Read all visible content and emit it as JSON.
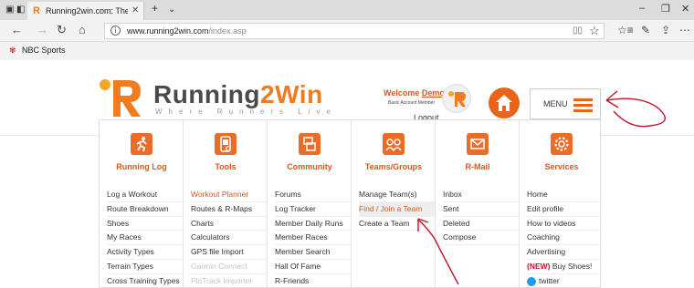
{
  "browser": {
    "tab_title": "Running2win.com: The",
    "url_domain": "www.running2win.com",
    "url_path": "/index.asp",
    "favorite": "NBC Sports"
  },
  "header": {
    "logo_word_a": "Running",
    "logo_word_b": "2Win",
    "tagline": "Where Runners Live",
    "welcome_prefix": "Welcome",
    "username": "Demo",
    "member_type": "Basic Account Member",
    "logout": "Logout",
    "menu_label": "MENU"
  },
  "menu": {
    "columns": [
      {
        "title": "Running Log",
        "icon": "runner-icon",
        "items": [
          "Log a Workout",
          "Route Breakdown",
          "Shoes",
          "My Races",
          "Activity Types",
          "Terrain Types",
          "Cross Training Types"
        ]
      },
      {
        "title": "Tools",
        "icon": "gps-device-icon",
        "items": [
          "Workout Planner",
          "Routes & R-Maps",
          "Charts",
          "Calculators",
          "GPS file Import",
          "Garmin Connect",
          "PloTrack Importer"
        ]
      },
      {
        "title": "Community",
        "icon": "community-icon",
        "items": [
          "Forums",
          "Log Tracker",
          "Member Daily Runs",
          "Member Races",
          "Member Search",
          "Hall Of Fame",
          "R-Friends"
        ]
      },
      {
        "title": "Teams/Groups",
        "icon": "group-icon",
        "items": [
          "Manage Team(s)",
          "Find / Join a Team",
          "Create a Team"
        ]
      },
      {
        "title": "R-Mail",
        "icon": "envelope-icon",
        "items": [
          "Inbox",
          "Sent",
          "Deleted",
          "Compose"
        ]
      },
      {
        "title": "Services",
        "icon": "gear-icon",
        "items": [
          "Home",
          "Edit profile",
          "How to videos",
          "Coaching",
          "Advertising",
          "(NEW)",
          "Buy Shoes!",
          "twitter"
        ]
      }
    ]
  },
  "colors": {
    "accent": "#e8641b",
    "link": "#d9561a",
    "annotation": "#c0152a"
  }
}
